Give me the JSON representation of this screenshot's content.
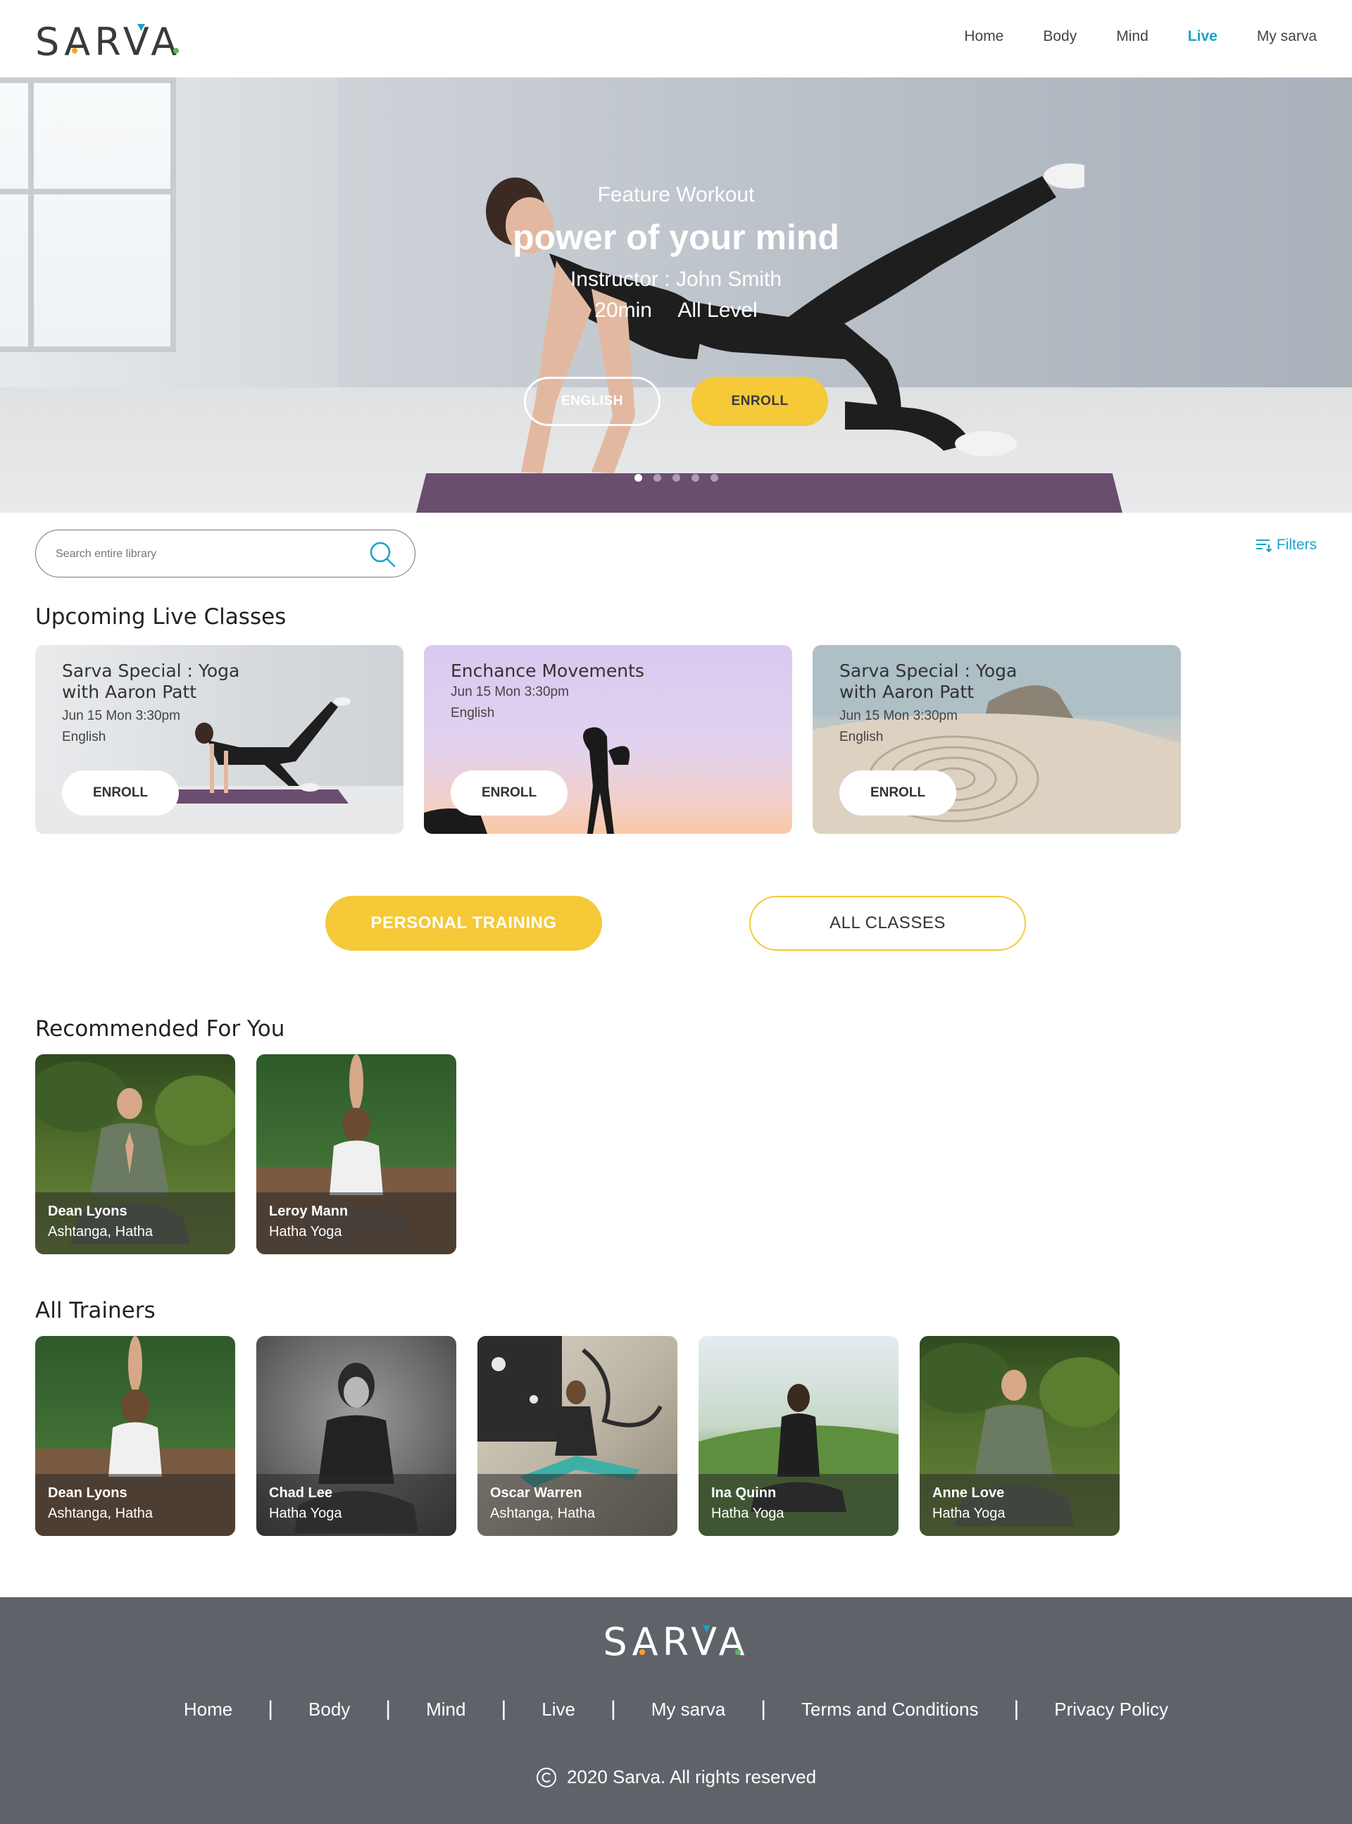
{
  "brand": {
    "name": "SARVA"
  },
  "nav": {
    "items": [
      {
        "label": "Home"
      },
      {
        "label": "Body"
      },
      {
        "label": "Mind"
      },
      {
        "label": "Live"
      },
      {
        "label": "My sarva"
      }
    ],
    "active": "Live",
    "accent": "#1ba3c6"
  },
  "hero": {
    "kicker": "Feature Workout",
    "title": "power of your mind",
    "instructor": "Instructor : John Smith",
    "duration": "20min",
    "level": "All Level",
    "lang_button": "ENGLISH",
    "enroll_button": "ENROLL",
    "slides_total": 5,
    "slide_active": 1
  },
  "search": {
    "placeholder": "Search entire library",
    "icon": "search-icon"
  },
  "filters": {
    "label": "Filters",
    "icon": "filter-icon"
  },
  "live": {
    "title": "Upcoming Live Classes",
    "cards": [
      {
        "title_line1": "Sarva Special : Yoga",
        "title_line2": "with Aaron Patt",
        "date": "Jun 15 Mon 3:30pm",
        "lang": "English",
        "button": "ENROLL"
      },
      {
        "title_line1": "Enchance Movements",
        "title_line2": "",
        "date": "Jun 15 Mon 3:30pm",
        "lang": "English",
        "button": "ENROLL"
      },
      {
        "title_line1": "Sarva Special : Yoga",
        "title_line2": "with Aaron Patt",
        "date": "Jun 15 Mon 3:30pm",
        "lang": "English",
        "button": "ENROLL"
      }
    ]
  },
  "cta": {
    "personal": "PERSONAL TRAINING",
    "all": "ALL CLASSES",
    "color": "#f5c937"
  },
  "recommended": {
    "title": "Recommended For You",
    "items": [
      {
        "name": "Dean Lyons",
        "style": "Ashtanga, Hatha"
      },
      {
        "name": "Leroy Mann",
        "style": "Hatha Yoga"
      }
    ]
  },
  "trainers": {
    "title": "All Trainers",
    "items": [
      {
        "name": "Dean Lyons",
        "style": "Ashtanga, Hatha"
      },
      {
        "name": "Chad Lee",
        "style": "Hatha Yoga"
      },
      {
        "name": "Oscar Warren",
        "style": "Ashtanga, Hatha"
      },
      {
        "name": "Ina Quinn",
        "style": "Hatha Yoga"
      },
      {
        "name": "Anne Love",
        "style": "Hatha Yoga"
      }
    ]
  },
  "footer": {
    "brand": "SARVA",
    "links": [
      "Home",
      "Body",
      "Mind",
      "Live",
      "My sarva",
      "Terms and Conditions",
      "Privacy Policy"
    ],
    "separator": "|",
    "copyright": "2020 Sarva. All rights reserved",
    "bg": "#5f6369"
  }
}
